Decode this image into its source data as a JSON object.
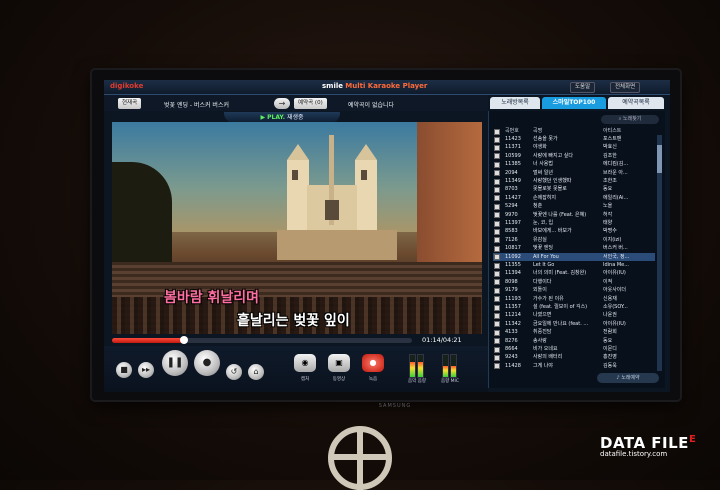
{
  "app": {
    "logo": "digikoke",
    "title_smile": "smile",
    "title_rest": "Multi Karaoke Player",
    "top_buttons": [
      "도움말",
      "전체화면"
    ]
  },
  "toolbar": {
    "list_button": "현재곡",
    "now_song": "벚꽃 엔딩 - 버스커 버스커",
    "next_arrow": "→",
    "reserve_button": "예약곡 (0)",
    "reserve_status": "예약곡이 없습니다"
  },
  "tabs": [
    "노래방목록",
    "스마일TOP100",
    "예약곡목록"
  ],
  "active_tab": 1,
  "play_status": {
    "play": "▶ PLAY.",
    "label": "재생중"
  },
  "lyrics": {
    "line1": "봄바람 휘날리며",
    "line2": "흩날리는 벚꽃 잎이"
  },
  "player": {
    "time": "01:14/04:21",
    "progress": 0.24,
    "buttons": [
      "stop",
      "next",
      "pause",
      "stop2",
      "pitch",
      "tempo"
    ],
    "round_buttons": [
      {
        "icon": "camera-icon",
        "label": "캡처"
      },
      {
        "icon": "video-icon",
        "label": "동영상"
      },
      {
        "icon": "record-icon",
        "label": "녹음"
      }
    ],
    "meters": [
      "음악 음량",
      "음향 MIC"
    ],
    "music_level": 0.7,
    "mic_level": 0.5
  },
  "songlist": {
    "search_button": "노래찾기",
    "reserve_button": "노래예약",
    "headers": {
      "num": "곡번호",
      "title": "곡명",
      "artist": "아티스트"
    },
    "selected_index": 14,
    "rows": [
      {
        "num": "11423",
        "title": "선송을 못가",
        "artist": "포스트맨"
      },
      {
        "num": "11371",
        "title": "야생화",
        "artist": "박효신"
      },
      {
        "num": "10599",
        "title": "사랑에 빠지고 싶다",
        "artist": "김조한"
      },
      {
        "num": "11385",
        "title": "너 사용법",
        "artist": "에디킴(김..."
      },
      {
        "num": "2094",
        "title": "벌써 일년",
        "artist": "브라운 아..."
      },
      {
        "num": "11349",
        "title": "사랑했던 인생했따",
        "artist": "조한조"
      },
      {
        "num": "8703",
        "title": "못몰로봇 못몰로",
        "artist": "동요"
      },
      {
        "num": "11427",
        "title": "손에잡히지",
        "artist": "에일리(Ai..."
      },
      {
        "num": "5294",
        "title": "청춘",
        "artist": "노을"
      },
      {
        "num": "9970",
        "title": "벚꽃엔 나를 (Feat. 은혜)",
        "artist": "허각"
      },
      {
        "num": "11397",
        "title": "눈, 코, 입",
        "artist": "태양"
      },
      {
        "num": "8583",
        "title": "바보에게... 바보가",
        "artist": "박명수"
      },
      {
        "num": "7126",
        "title": "유감실",
        "artist": "이지(izi)"
      },
      {
        "num": "10817",
        "title": "벚꽃 엔딩",
        "artist": "버스커 버..."
      },
      {
        "num": "11092",
        "title": "All For You",
        "artist": "서인국, 정..."
      },
      {
        "num": "11355",
        "title": "Let It Go",
        "artist": "Idina Me..."
      },
      {
        "num": "11394",
        "title": "너의 의미 (Feat. 김창완)",
        "artist": "아이유(IU)"
      },
      {
        "num": "8098",
        "title": "다행이다",
        "artist": "이적"
      },
      {
        "num": "9179",
        "title": "외톨이",
        "artist": "아웃사이더"
      },
      {
        "num": "11193",
        "title": "가수가 된 이유",
        "artist": "신용재"
      },
      {
        "num": "11357",
        "title": "설 (feat. 릴보이 of 긱스)",
        "artist": "소유(SOY..."
      },
      {
        "num": "11214",
        "title": "나였으면",
        "artist": "나윤권"
      },
      {
        "num": "11342",
        "title": "금요일에 만나요 (feat. ...",
        "artist": "아이유(IU)"
      },
      {
        "num": "4133",
        "title": "취중진담",
        "artist": "전람회"
      },
      {
        "num": "8276",
        "title": "송사랑",
        "artist": "동요"
      },
      {
        "num": "8664",
        "title": "비가 오네요",
        "artist": "이문디"
      },
      {
        "num": "9243",
        "title": "사랑의 배터리",
        "artist": "홍진영"
      },
      {
        "num": "11428",
        "title": "그게 나야",
        "artist": "김동욱"
      }
    ]
  },
  "tv_brand": "SAMSUNG",
  "watermark": {
    "line1": "DATA FILE",
    "mark": "E",
    "line2": "datafile.tistory.com"
  },
  "colors": {
    "accent_red": "#e03b2d",
    "tab_active": "#1a9de0",
    "selected_row": "#2b4b78",
    "lyric_pink": "#ff6fa0"
  }
}
